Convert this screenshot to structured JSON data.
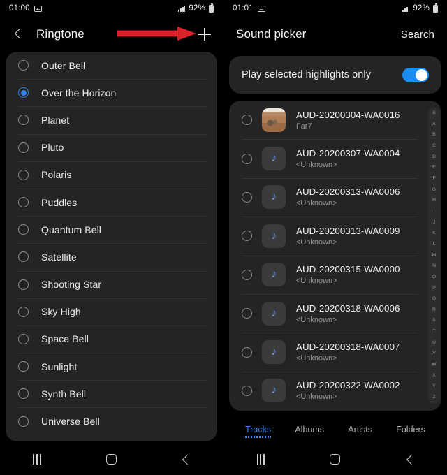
{
  "colors": {
    "accent_blue": "#2f80ef",
    "toggle_blue": "#1b8cf0",
    "tab_blue": "#3a86f2",
    "annotation_red": "#d82129",
    "card_bg": "#242424",
    "screen_bg": "#000000"
  },
  "left_panel": {
    "status_bar": {
      "time": "01:00",
      "battery": "92%",
      "gallery_icon": "gallery-icon",
      "signal_icon": "signal-bars-icon",
      "battery_icon": "battery-icon"
    },
    "app_bar": {
      "back_icon": "back-chevron-icon",
      "title": "Ringtone",
      "add_icon": "plus-icon"
    },
    "annotation": {
      "type": "red-arrow",
      "points_to": "plus-icon"
    },
    "selected_item": "Over the Horizon",
    "items": [
      {
        "label": "Outer Bell",
        "selected": false
      },
      {
        "label": "Over the Horizon",
        "selected": true
      },
      {
        "label": "Planet",
        "selected": false
      },
      {
        "label": "Pluto",
        "selected": false
      },
      {
        "label": "Polaris",
        "selected": false
      },
      {
        "label": "Puddles",
        "selected": false
      },
      {
        "label": "Quantum Bell",
        "selected": false
      },
      {
        "label": "Satellite",
        "selected": false
      },
      {
        "label": "Shooting Star",
        "selected": false
      },
      {
        "label": "Sky High",
        "selected": false
      },
      {
        "label": "Space Bell",
        "selected": false
      },
      {
        "label": "Sunlight",
        "selected": false
      },
      {
        "label": "Synth Bell",
        "selected": false
      },
      {
        "label": "Universe Bell",
        "selected": false
      }
    ],
    "nav_bar": {
      "recents": "recents-icon",
      "home": "home-icon",
      "back": "back-icon"
    }
  },
  "right_panel": {
    "status_bar": {
      "time": "01:01",
      "battery": "92%",
      "gallery_icon": "gallery-icon",
      "signal_icon": "signal-bars-icon",
      "battery_icon": "battery-icon"
    },
    "app_bar": {
      "title": "Sound picker",
      "search_label": "Search"
    },
    "toggle_row": {
      "label": "Play selected highlights only",
      "enabled": true
    },
    "tracks": [
      {
        "title": "AUD-20200304-WA0016",
        "artist": "Far7",
        "thumb": "photo-thumbnail",
        "selected": false
      },
      {
        "title": "AUD-20200307-WA0004",
        "artist": "<Unknown>",
        "thumb": "music-note-icon",
        "selected": false
      },
      {
        "title": "AUD-20200313-WA0006",
        "artist": "<Unknown>",
        "thumb": "music-note-icon",
        "selected": false
      },
      {
        "title": "AUD-20200313-WA0009",
        "artist": "<Unknown>",
        "thumb": "music-note-icon",
        "selected": false
      },
      {
        "title": "AUD-20200315-WA0000",
        "artist": "<Unknown>",
        "thumb": "music-note-icon",
        "selected": false
      },
      {
        "title": "AUD-20200318-WA0006",
        "artist": "<Unknown>",
        "thumb": "music-note-icon",
        "selected": false
      },
      {
        "title": "AUD-20200318-WA0007",
        "artist": "<Unknown>",
        "thumb": "music-note-icon",
        "selected": false
      },
      {
        "title": "AUD-20200322-WA0002",
        "artist": "<Unknown>",
        "thumb": "music-note-icon",
        "selected": false
      }
    ],
    "alpha_index": [
      "&",
      "A",
      "B",
      "C",
      "D",
      "E",
      "F",
      "G",
      "H",
      "I",
      "J",
      "K",
      "L",
      "M",
      "N",
      "O",
      "P",
      "Q",
      "R",
      "S",
      "T",
      "U",
      "V",
      "W",
      "X",
      "Y",
      "Z"
    ],
    "tabs": [
      {
        "label": "Tracks",
        "active": true
      },
      {
        "label": "Albums",
        "active": false
      },
      {
        "label": "Artists",
        "active": false
      },
      {
        "label": "Folders",
        "active": false
      }
    ],
    "nav_bar": {
      "recents": "recents-icon",
      "home": "home-icon",
      "back": "back-icon"
    }
  }
}
